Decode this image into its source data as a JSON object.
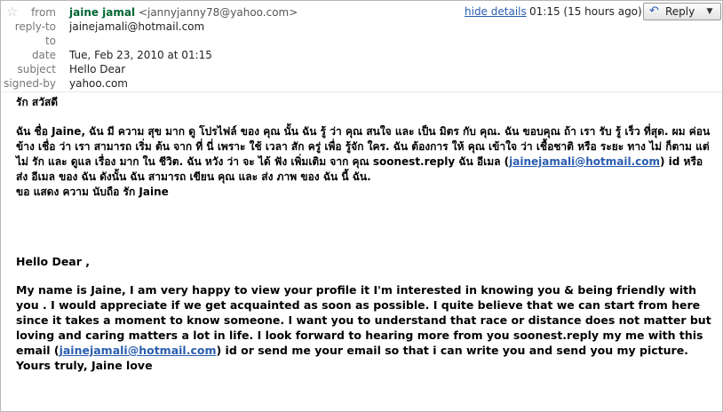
{
  "header": {
    "star_icon": "star-icon",
    "from_label": "from",
    "from_name": "jaine jamal",
    "from_email": "<jannyjanny78@yahoo.com>",
    "replyto_label": "reply-to",
    "replyto_value": "jainejamali@hotmail.com",
    "to_label": "to",
    "to_value": "",
    "date_label": "date",
    "date_value": "Tue, Feb 23, 2010 at 01:15",
    "subject_label": "subject",
    "subject_value": "Hello Dear",
    "signedby_label": "signed-by",
    "signedby_value": "yahoo.com",
    "hide_details": "hide details",
    "time": "01:15 (15 hours ago)",
    "reply_label": "Reply",
    "reply_icon": "reply-arrow-icon",
    "dropdown_icon": "chevron-down-icon"
  },
  "body": {
    "thai_greeting": "รัก สวัสดี",
    "thai_text_1": "ฉัน ชื่อ Jaine, ฉัน มี ความ สุข มาก ดู โปรไฟล์ ของ คุณ นั้น ฉัน รู้ ว่า คุณ สนใจ และ เป็น มิตร กับ คุณ. ฉัน ขอบคุณ ถ้า เรา รับ รู้ เร็ว ที่สุด. ผม ค่อนข้าง เชื่อ ว่า เรา สามารถ เริ่ม ต้น จาก ที่ นี่ เพราะ ใช้ เวลา สัก ครู่ เพื่อ รู้จัก ใคร. ฉัน ต้องการ ให้ คุณ เข้าใจ ว่า เชื้อชาติ หรือ ระยะ ทาง ไม่ ก็ตาม แต่ ไม่ รัก และ ดูแล เรื่อง มาก ใน ชีวิต. ฉัน หวัง ว่า จะ ได้ ฟัง เพิ่มเติม จาก คุณ soonest.reply ฉัน อีเมล (",
    "thai_link": "jainejamali@hotmail.com",
    "thai_text_2": ") id หรือ ส่ง อีเมล ของ ฉัน ดังนั้น ฉัน สามารถ เขียน คุณ และ ส่ง ภาพ ของ ฉัน นี้ ฉัน.",
    "thai_sign": "ขอ แสดง ความ นับถือ รัก Jaine",
    "en_greeting": "Hello Dear ,",
    "en_text_1": "My name is Jaine, I am very happy to view your profile it   I'm interested in knowing you & being friendly with you . I would appreciate if we get acquainted as soon as possible. I quite believe that we can start from here since it takes a moment to know someone. I want you to understand that race or distance does not matter but loving and caring matters a lot in life. I look forward to hearing more from you soonest.reply my me with this email (",
    "en_link": "jainejamali@hotmail.com",
    "en_text_2": ") id or send me your email so that i can write you and send you my picture.",
    "en_sign": "Yours truly, Jaine love"
  }
}
